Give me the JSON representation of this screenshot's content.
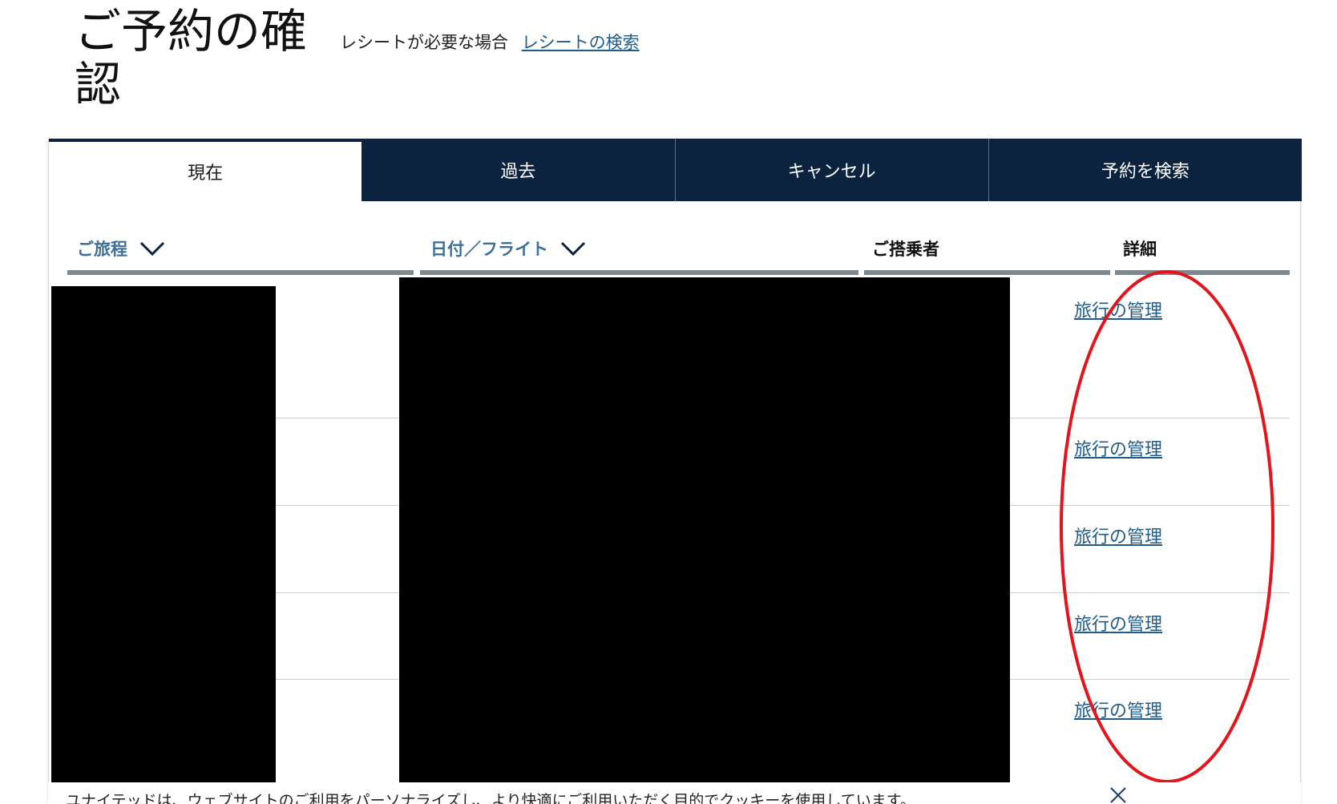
{
  "page": {
    "title": "ご予約の確認",
    "receipt_prompt": "レシートが必要な場合",
    "receipt_link": "レシートの検索"
  },
  "tabs": [
    {
      "label": "現在",
      "active": true
    },
    {
      "label": "過去",
      "active": false
    },
    {
      "label": "キャンセル",
      "active": false
    },
    {
      "label": "予約を検索",
      "active": false
    }
  ],
  "table": {
    "columns": {
      "itinerary": "ご旅程",
      "date_flight": "日付／フライト",
      "passengers": "ご搭乗者",
      "details": "詳細"
    },
    "rows": [
      {
        "details_link": "旅行の管理"
      },
      {
        "details_link": "旅行の管理"
      },
      {
        "details_link": "旅行の管理"
      },
      {
        "details_link": "旅行の管理"
      },
      {
        "details_link": "旅行の管理"
      }
    ]
  },
  "cookie_banner": {
    "text": "ユナイテッドは、ウェブサイトのご利用をパーソナライズし、より快適にご利用いただく目的でクッキーを使用しています。"
  },
  "colors": {
    "tab_navy": "#0c2340",
    "link_blue": "#1f5c8b",
    "sort_header_blue": "#3d6f99",
    "annotation_red": "#e3141b"
  },
  "icons": {
    "sort": "chevron-down-icon",
    "close": "close-icon"
  }
}
